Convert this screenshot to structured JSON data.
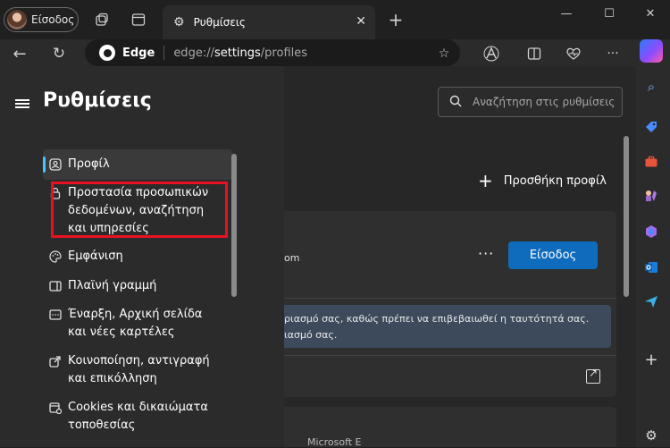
{
  "window": {
    "profile_label": "Είσοδος",
    "tab_title": "Ρυθμίσεις",
    "min_glyph": "—",
    "max_glyph": "☐",
    "close_glyph": "✕"
  },
  "toolbar": {
    "brand": "Edge",
    "url_prefix": "edge://",
    "url_host": "settings",
    "url_path": "/profiles"
  },
  "settings": {
    "title": "Ρυθμίσεις",
    "search_placeholder": "Αναζήτηση στις ρυθμίσεις",
    "nav_items": [
      {
        "label": "Προφίλ",
        "icon": "profile-icon"
      },
      {
        "label": "Προστασία προσωπικών δεδομένων, αναζήτηση και υπηρεσίες",
        "icon": "lock-icon"
      },
      {
        "label": "Εμφάνιση",
        "icon": "palette-icon"
      },
      {
        "label": "Πλαϊνή γραμμή",
        "icon": "sidebar-icon"
      },
      {
        "label": "Έναρξη, Αρχική σελίδα και νέες καρτέλες",
        "icon": "home-tabs-icon"
      },
      {
        "label": "Κοινοποίηση, αντιγραφή και επικόλληση",
        "icon": "share-icon"
      },
      {
        "label": "Cookies και δικαιώματα τοποθεσίας",
        "icon": "cookie-icon"
      }
    ]
  },
  "main": {
    "add_profile": "Προσθήκη προφίλ",
    "email_fragment": "om",
    "more_dots": "···",
    "signin_button": "Είσοδος",
    "notice_line1": "ριασμό σας, καθώς πρέπει να επιβεβαιωθεί η ταυτότητά σας.",
    "notice_line2": "ιασμό σας.",
    "bottom_fragment": "Microsoft E"
  },
  "colors": {
    "accent": "#0f6cbd",
    "active_indicator": "#4cc2ff",
    "highlight_box": "#e81123"
  }
}
